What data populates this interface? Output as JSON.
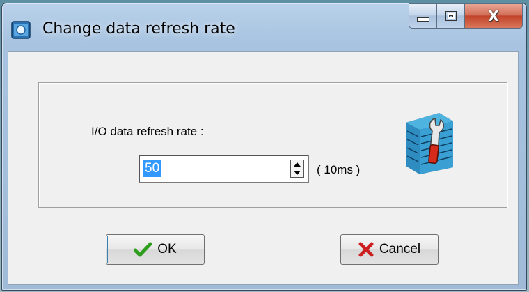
{
  "window": {
    "title": "Change data refresh rate",
    "close_glyph": "X"
  },
  "form": {
    "rate_label": "I/O data refresh rate :",
    "rate_value": "50",
    "unit_label": "( 10ms )"
  },
  "buttons": {
    "ok_label": "OK",
    "cancel_label": "Cancel"
  },
  "icons": {
    "app": "app-icon",
    "tool": "settings-tool-icon",
    "ok": "checkmark-icon",
    "cancel": "x-cross-icon",
    "spin_up": "arrow-up-icon",
    "spin_down": "arrow-down-icon"
  },
  "colors": {
    "selection": "#3399ff",
    "checkmark": "#2f9e1f",
    "cross": "#cc1f1f",
    "close_button": "#c2432a"
  }
}
